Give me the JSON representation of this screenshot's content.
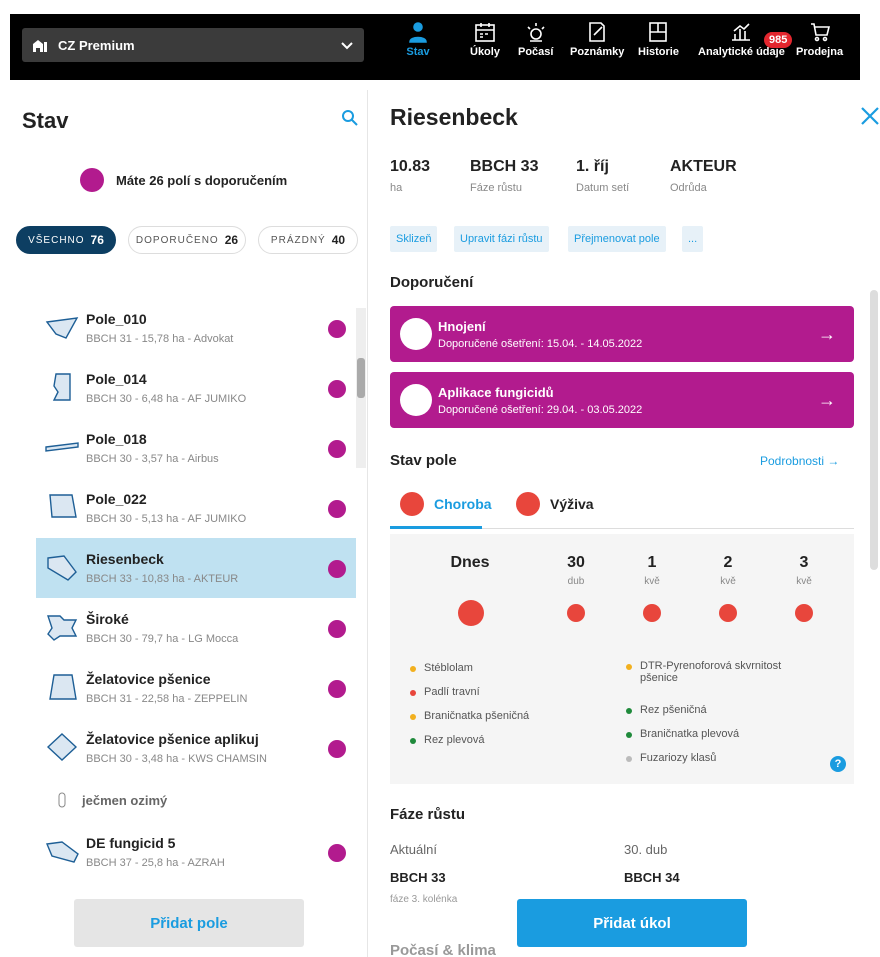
{
  "topbar": {
    "farm": "CZ Premium",
    "nav": [
      {
        "label": "Stav",
        "icon": "person-pin-icon"
      },
      {
        "label": "Úkoly",
        "icon": "calendar-icon"
      },
      {
        "label": "Počasí",
        "icon": "weather-icon"
      },
      {
        "label": "Poznámky",
        "icon": "notes-icon"
      },
      {
        "label": "Historie",
        "icon": "history-icon"
      },
      {
        "label": "Analytické údaje",
        "icon": "analytics-icon"
      },
      {
        "label": "Prodejna",
        "icon": "cart-icon"
      }
    ],
    "badge": "985"
  },
  "left": {
    "title": "Stav",
    "banner": "Máte 26 polí s doporučením",
    "chips": [
      {
        "label": "VŠECHNO",
        "count": "76"
      },
      {
        "label": "DOPORUČENO",
        "count": "26"
      },
      {
        "label": "PRÁZDNÝ",
        "count": "40"
      }
    ],
    "fields": [
      {
        "name": "Pole_010",
        "meta": "BBCH 31 - 15,78 ha - Advokat"
      },
      {
        "name": "Pole_014",
        "meta": "BBCH 30 - 6,48 ha - AF JUMIKO"
      },
      {
        "name": "Pole_018",
        "meta": "BBCH 30 - 3,57 ha - Airbus"
      },
      {
        "name": "Pole_022",
        "meta": "BBCH 30 - 5,13 ha - AF JUMIKO"
      },
      {
        "name": "Riesenbeck",
        "meta": "BBCH 33 - 10,83 ha - AKTEUR"
      },
      {
        "name": "Široké",
        "meta": "BBCH 30 - 79,7 ha - LG Mocca"
      },
      {
        "name": "Želatovice pšenice",
        "meta": "BBCH 31 - 22,58 ha - ZEPPELIN"
      },
      {
        "name": "Želatovice pšenice aplikuj",
        "meta": "BBCH 30 - 3,48 ha - KWS CHAMSIN"
      }
    ],
    "group": "ječmen ozimý",
    "group_fields": [
      {
        "name": "DE fungicid 5",
        "meta": "BBCH 37 - 25,8 ha - AZRAH"
      }
    ],
    "add_field": "Přidat pole"
  },
  "right": {
    "title": "Riesenbeck",
    "stats": [
      {
        "value": "10.83",
        "label": "ha"
      },
      {
        "value": "BBCH 33",
        "label": "Fáze růstu"
      },
      {
        "value": "1. říj",
        "label": "Datum setí"
      },
      {
        "value": "AKTEUR",
        "label": "Odrůda"
      }
    ],
    "actions": [
      "Sklizeň",
      "Upravit fázi růstu",
      "Přejmenovat pole",
      "..."
    ],
    "recommendation_title": "Doporučení",
    "recommendations": [
      {
        "title": "Hnojení",
        "date": "Doporučené ošetření: 15.04. - 14.05.2022"
      },
      {
        "title": "Aplikace fungicidů",
        "date": "Doporučené ošetření: 29.04. - 03.05.2022"
      }
    ],
    "field_state": "Stav pole",
    "details": "Podrobnosti →",
    "tabs": [
      "Choroba",
      "Výživa"
    ],
    "forecast": [
      {
        "day": "Dnes",
        "month": ""
      },
      {
        "day": "30",
        "month": "dub"
      },
      {
        "day": "1",
        "month": "kvě"
      },
      {
        "day": "2",
        "month": "kvě"
      },
      {
        "day": "3",
        "month": "kvě"
      }
    ],
    "legend_left": [
      {
        "label": "Stéblolam",
        "color": "#f2b01e"
      },
      {
        "label": "Padlí travní",
        "color": "#e8463c"
      },
      {
        "label": "Braničnatka pšeničná",
        "color": "#f2b01e"
      },
      {
        "label": "Rez plevová",
        "color": "#1f8a3b"
      }
    ],
    "legend_right": [
      {
        "label": "DTR-Pyrenoforová skvrnitost pšenice",
        "color": "#f2b01e"
      },
      {
        "label": "Rez pšeničná",
        "color": "#1f8a3b"
      },
      {
        "label": "Braničnatka plevová",
        "color": "#1f8a3b"
      },
      {
        "label": "Fuzariozy klasů",
        "color": "#bbbbbb"
      }
    ],
    "growth_title": "Fáze růstu",
    "growth": {
      "current_label": "Aktuální",
      "current_value": "BBCH 33",
      "current_desc": "fáze 3. kolénka",
      "next_label": "30. dub",
      "next_value": "BBCH 34"
    },
    "add_task": "Přidat úkol",
    "weather": "Počasí & klima"
  }
}
